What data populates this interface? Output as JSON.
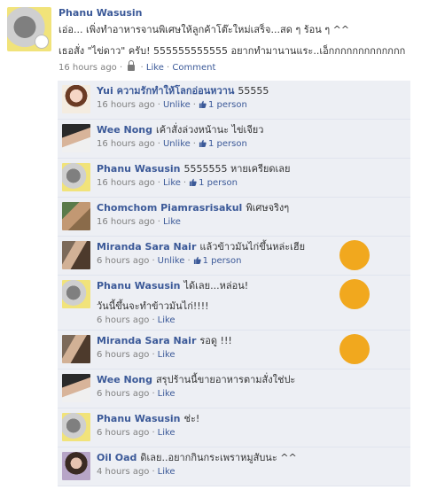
{
  "post": {
    "author": "Phanu Wasusin",
    "line1": "เอ่อ... เพิ่งทำอาหารจานพิเศษให้ลูกค้าโต๊ะใหม่เสร็จ...สด ๆ ร้อน ๆ ^^",
    "line2": "เธอสั่ง \"ไข่ดาว\" ครับ! 555555555555 อยากทำมานานแระ..เอ็กกกกกกกกกกกกก",
    "time": "16 hours ago",
    "sep": "·",
    "like": "Like",
    "comment": "Comment"
  },
  "comments": [
    {
      "name": "Yui ความรักทำให้โลกอ่อนหวาน",
      "text": "55555",
      "time": "16 hours ago",
      "action": "Unlike",
      "likes": "1 person",
      "avatar": "yui",
      "has_orange": false
    },
    {
      "name": "Wee Nong",
      "text": "เค้าสั่งล่วงหน้านะ ไข่เจียว",
      "time": "16 hours ago",
      "action": "Unlike",
      "likes": "1 person",
      "avatar": "wee",
      "has_orange": false
    },
    {
      "name": "Phanu Wasusin",
      "text": "5555555 หายเครียดเลย",
      "time": "16 hours ago",
      "action": "Like",
      "likes": "1 person",
      "avatar": "phanu",
      "has_orange": false
    },
    {
      "name": "Chomchom Piamrasrisakul",
      "text": "พิเศษจริงๆ",
      "time": "16 hours ago",
      "action": "Like",
      "likes": "",
      "avatar": "chom",
      "has_orange": false
    },
    {
      "name": "Miranda Sara Nair",
      "text": "แล้วข้าวมันไก่ขึ้นหล่ะเฮีย",
      "time": "6 hours ago",
      "action": "Unlike",
      "likes": "1 person",
      "avatar": "miranda",
      "has_orange": true
    },
    {
      "name": "Phanu Wasusin",
      "text": "ได้เลย...หล่อน!",
      "text2": "วันนี้ขึ้นจะทำข้าวมันไก่!!!!",
      "time": "6 hours ago",
      "action": "Like",
      "likes": "",
      "avatar": "phanu",
      "has_orange": true
    },
    {
      "name": "Miranda Sara Nair",
      "text": "รอดู !!!",
      "time": "6 hours ago",
      "action": "Like",
      "likes": "",
      "avatar": "miranda",
      "has_orange": true
    },
    {
      "name": "Wee Nong",
      "text": "สรุปร้านนี้ขายอาหารตามสั่งใช่ปะ",
      "time": "6 hours ago",
      "action": "Like",
      "likes": "",
      "avatar": "wee",
      "has_orange": false
    },
    {
      "name": "Phanu Wasusin",
      "text": "ช่ะ!",
      "time": "6 hours ago",
      "action": "Like",
      "likes": "",
      "avatar": "phanu",
      "has_orange": false
    },
    {
      "name": "Oil Oad",
      "text": "ดิเลย..อยากกินกระเพราหมูสับนะ ^^",
      "time": "4 hours ago",
      "action": "Like",
      "likes": "",
      "avatar": "oil",
      "has_orange": false
    }
  ],
  "colors": {
    "link": "#3b5998",
    "comment_bg": "#edeff4",
    "orange": "#f1a81e"
  }
}
